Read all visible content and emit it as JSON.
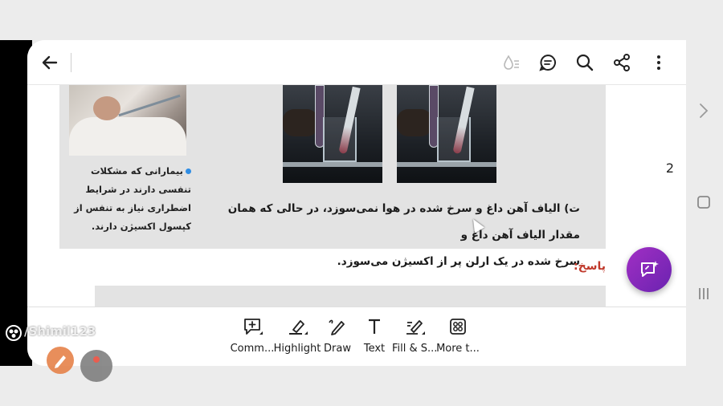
{
  "colors": {
    "background": "#ececec",
    "panel": "#e3e3e3",
    "answer_label": "#c0392b",
    "fab": "#8a2bc2"
  },
  "appbar": {
    "icons": [
      "back-arrow-icon",
      "text-reflow-icon",
      "comments-icon",
      "search-icon",
      "share-icon",
      "more-vertical-icon"
    ]
  },
  "document": {
    "caption": "بیمارانی که مشکلات تنفسی دارند در شرایط اضطراری نیاز به تنفس از کپسول اکسیژن دارند.",
    "paragraph_line1": "ت) الیاف آهن داغ و سرخ شده در هوا نمی‌سوزد، در حالی که همان مقدار الیاف آهن داغ و",
    "paragraph_line2": "سرخ شده در یک ارلن پر از اکسیژن می‌سوزد.",
    "answer_label": "پاسخ:"
  },
  "page_number": "2",
  "toolbar": {
    "items": [
      {
        "label": "Comm...",
        "icon": "add-comment-icon"
      },
      {
        "label": "Highlight",
        "icon": "highlight-icon"
      },
      {
        "label": "Draw",
        "icon": "draw-icon"
      },
      {
        "label": "Text",
        "icon": "text-icon"
      },
      {
        "label": "Fill & S...",
        "icon": "fill-sign-icon"
      },
      {
        "label": "More t...",
        "icon": "more-tools-icon"
      }
    ]
  },
  "watermark": "/Shimil123"
}
